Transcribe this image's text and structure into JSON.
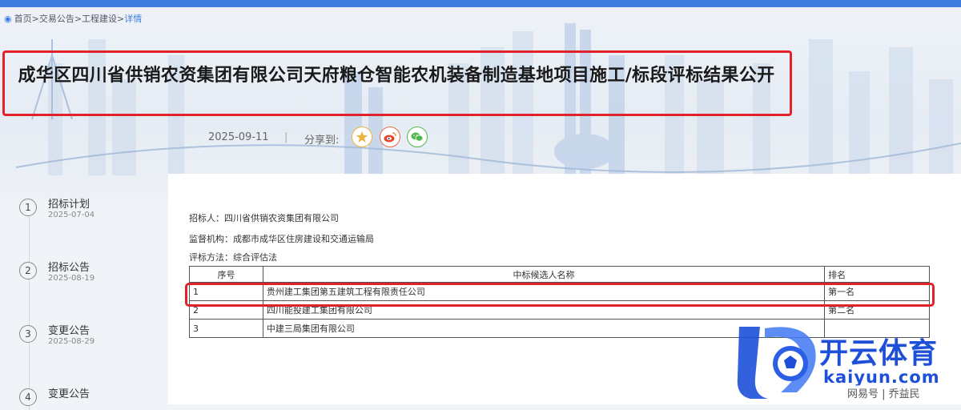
{
  "breadcrumb": {
    "home": "首页",
    "sep1": ">",
    "section": "交易公告",
    "sep2": ">",
    "category": "工程建设",
    "sep3": ">",
    "current": "详情"
  },
  "title": "成华区四川省供销农资集团有限公司天府粮仓智能农机装备制造基地项目施工/标段评标结果公开",
  "date": "2025-09-11",
  "separator": "|",
  "share": {
    "label": "分享到:",
    "buttons": [
      "favorite-icon",
      "weibo-icon",
      "wechat-icon"
    ]
  },
  "timeline": [
    {
      "step": "1",
      "name": "招标计划",
      "date": "2025-07-04"
    },
    {
      "step": "2",
      "name": "招标公告",
      "date": "2025-08-19"
    },
    {
      "step": "3",
      "name": "变更公告",
      "date": "2025-08-29"
    },
    {
      "step": "4",
      "name": "变更公告",
      "date": ""
    }
  ],
  "info": {
    "tenderer": "招标人：四川省供销农资集团有限公司",
    "supervisor": "监督机构：成都市成华区住房建设和交通运输局",
    "method": "评标方法：综合评估法"
  },
  "table": {
    "headers": [
      "序号",
      "中标候选人名称",
      "排名"
    ],
    "rows": [
      [
        "1",
        "贵州建工集团第五建筑工程有限责任公司",
        "第一名"
      ],
      [
        "2",
        "四川能投建工集团有限公司",
        "第二名"
      ],
      [
        "3",
        "中建三局集团有限公司",
        ""
      ]
    ]
  },
  "watermark": {
    "brand": "开云体育",
    "domain": "kaiyun.com",
    "credit": "网易号 | 乔益民"
  },
  "colors": {
    "accent": "#3d7de0",
    "highlight_box": "#e0232b",
    "watermark_blue": "#1d4fd8"
  }
}
